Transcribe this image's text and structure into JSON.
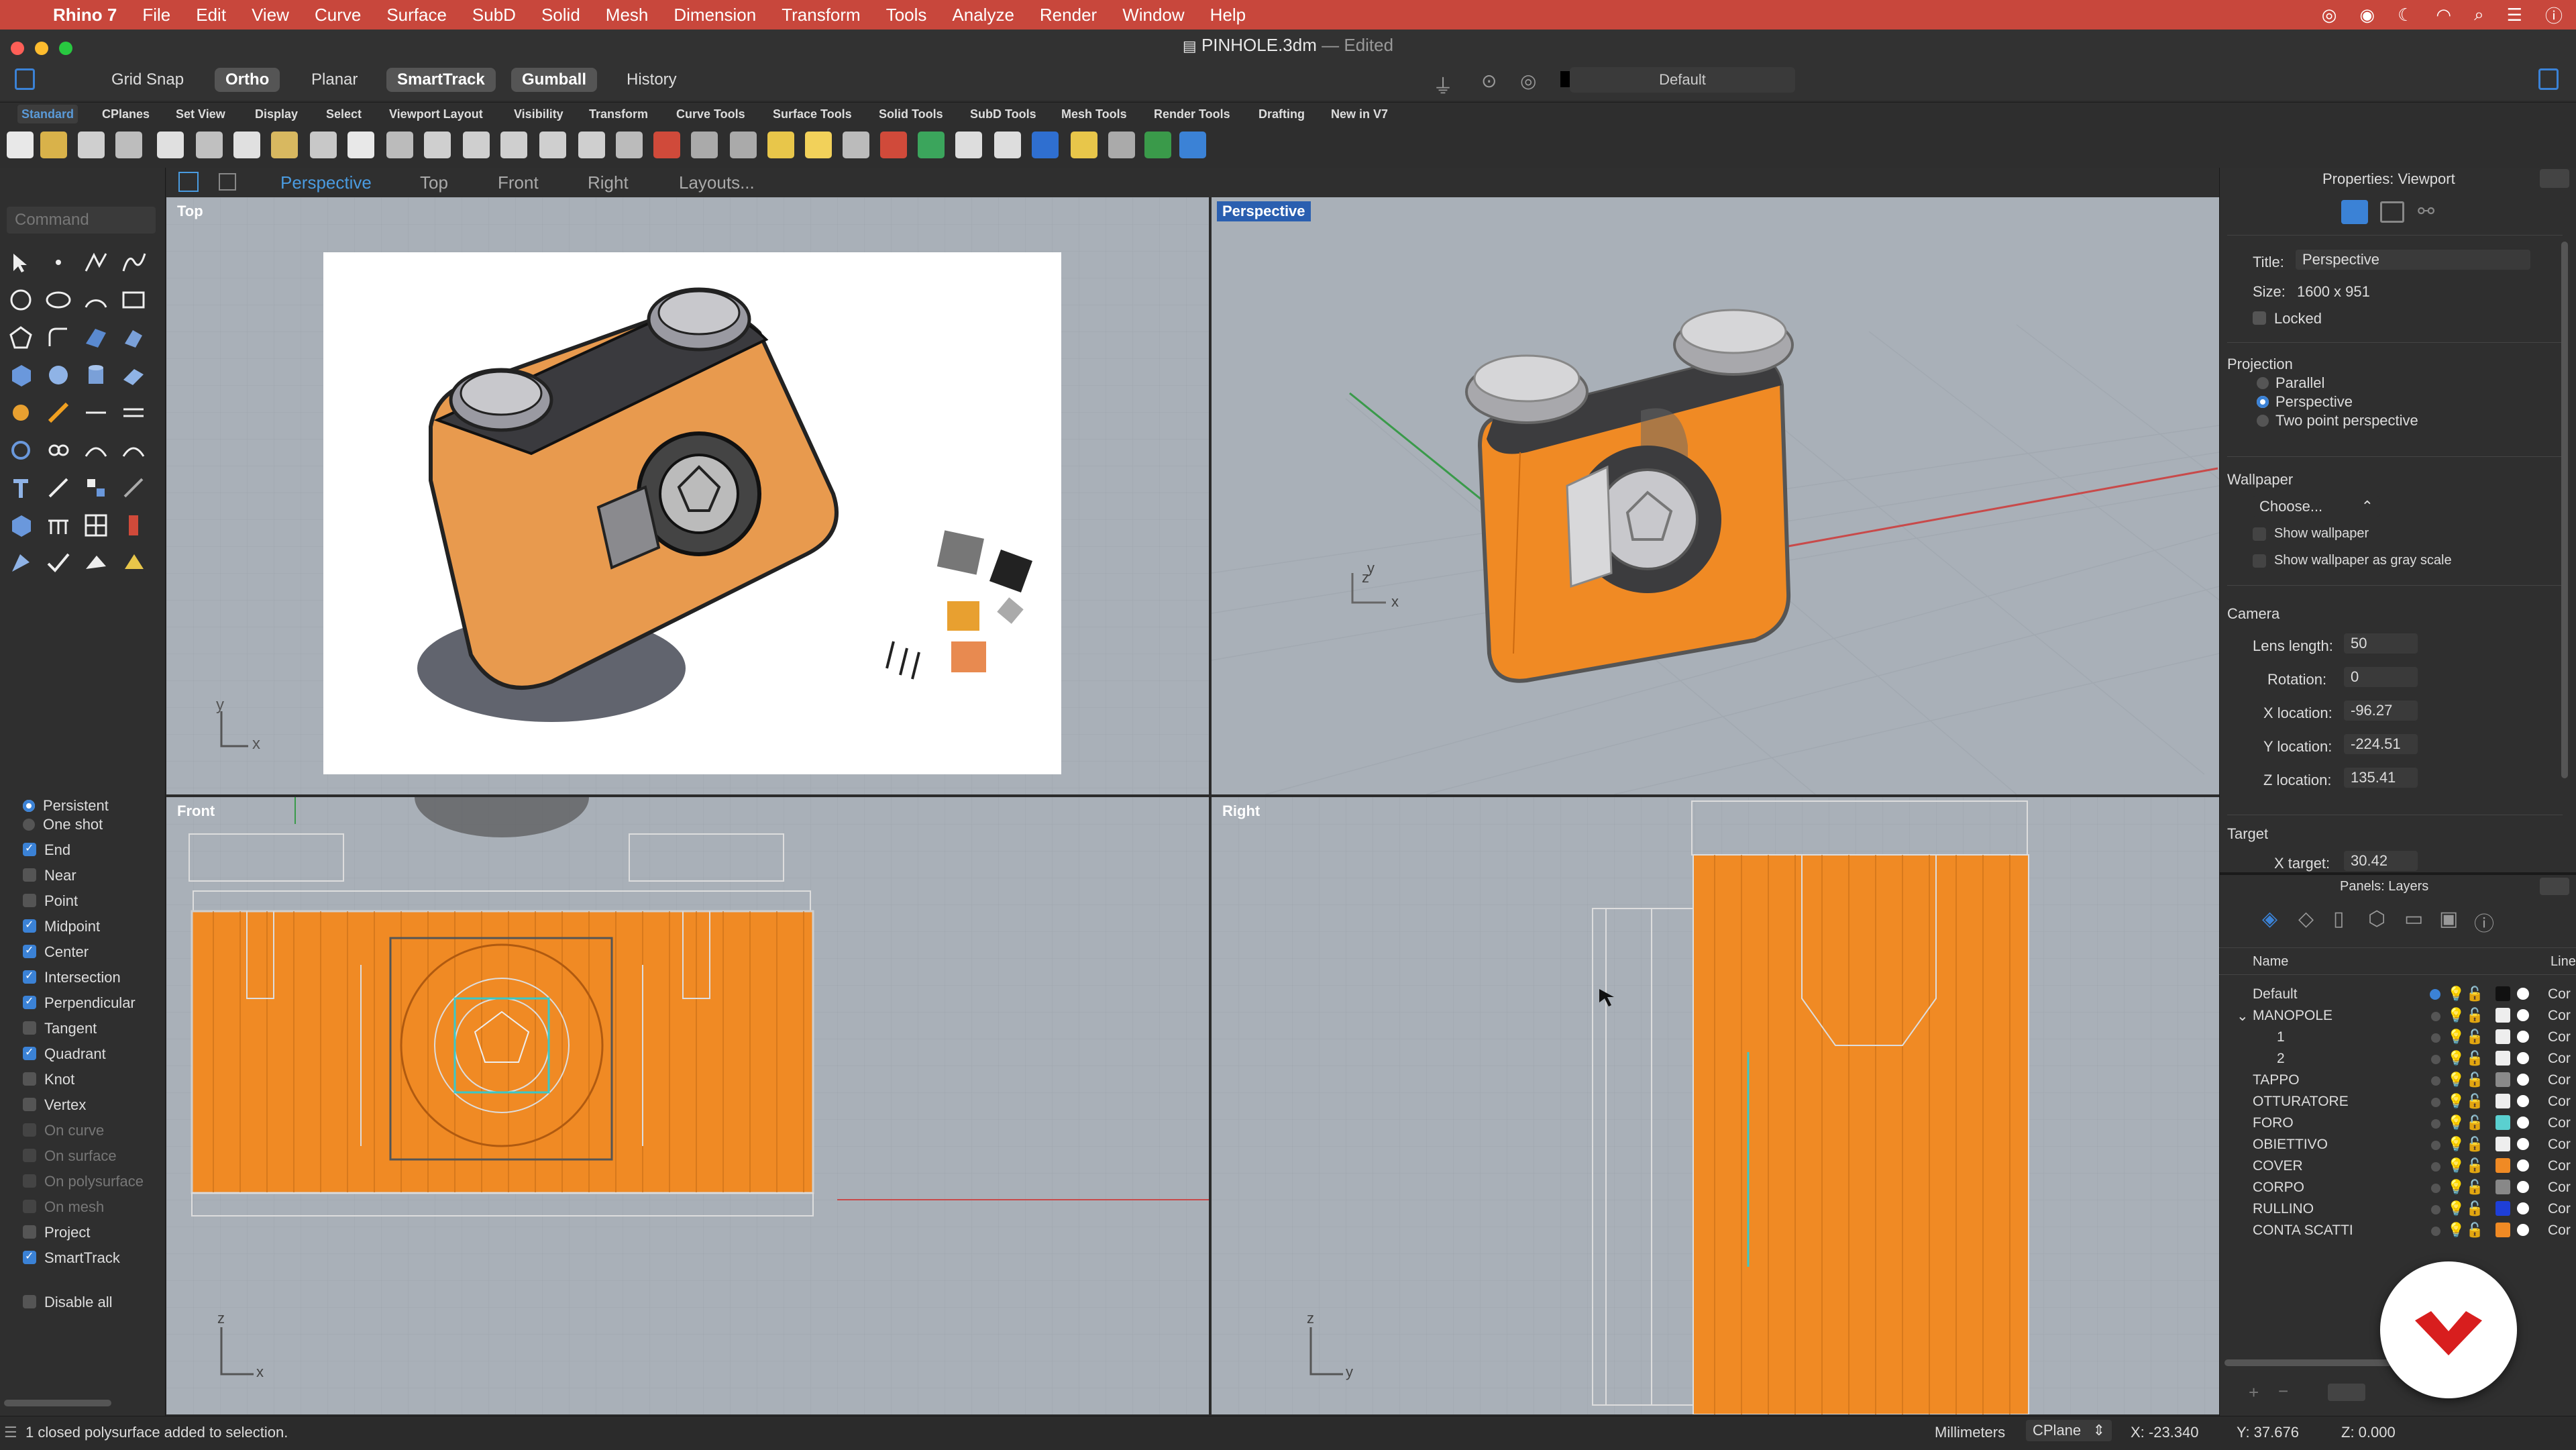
{
  "menubar": {
    "app": "Rhino 7",
    "items": [
      "File",
      "Edit",
      "View",
      "Curve",
      "Surface",
      "SubD",
      "Solid",
      "Mesh",
      "Dimension",
      "Transform",
      "Tools",
      "Analyze",
      "Render",
      "Window",
      "Help"
    ]
  },
  "window": {
    "filename": "PINHOLE.3dm",
    "status": "— Edited"
  },
  "toolbar": {
    "grid_snap": "Grid Snap",
    "ortho": "Ortho",
    "planar": "Planar",
    "smarttrack": "SmartTrack",
    "gumball": "Gumball",
    "history": "History",
    "layer": "Default"
  },
  "tabs": [
    "Standard",
    "CPlanes",
    "Set View",
    "Display",
    "Select",
    "Viewport Layout",
    "Visibility",
    "Transform",
    "Curve Tools",
    "Surface Tools",
    "Solid Tools",
    "SubD Tools",
    "Mesh Tools",
    "Render Tools",
    "Drafting",
    "New in V7"
  ],
  "command": {
    "placeholder": "Command"
  },
  "viewport_tabs": [
    "Perspective",
    "Top",
    "Front",
    "Right",
    "Layouts..."
  ],
  "viewports": {
    "top": "Top",
    "perspective": "Perspective",
    "front": "Front",
    "right": "Right"
  },
  "osnap": {
    "persistent": "Persistent",
    "one_shot": "One shot",
    "items": [
      {
        "label": "End",
        "checked": true
      },
      {
        "label": "Near",
        "checked": false
      },
      {
        "label": "Point",
        "checked": false
      },
      {
        "label": "Midpoint",
        "checked": true
      },
      {
        "label": "Center",
        "checked": true
      },
      {
        "label": "Intersection",
        "checked": true
      },
      {
        "label": "Perpendicular",
        "checked": true
      },
      {
        "label": "Tangent",
        "checked": false
      },
      {
        "label": "Quadrant",
        "checked": true
      },
      {
        "label": "Knot",
        "checked": false
      },
      {
        "label": "Vertex",
        "checked": false
      },
      {
        "label": "On curve",
        "checked": false
      },
      {
        "label": "On surface",
        "checked": false
      },
      {
        "label": "On polysurface",
        "checked": false
      },
      {
        "label": "On mesh",
        "checked": false
      },
      {
        "label": "Project",
        "checked": false
      },
      {
        "label": "SmartTrack",
        "checked": true
      }
    ],
    "disable_all": "Disable all"
  },
  "properties": {
    "title": "Properties: Viewport",
    "title_label": "Title:",
    "title_value": "Perspective",
    "size_label": "Size:",
    "size_value": "1600 x 951",
    "locked": "Locked",
    "projection": "Projection",
    "proj_options": [
      "Parallel",
      "Perspective",
      "Two point perspective"
    ],
    "wallpaper": "Wallpaper",
    "choose": "Choose...",
    "show_wallpaper": "Show wallpaper",
    "show_gray": "Show wallpaper as gray scale",
    "camera": "Camera",
    "lens_label": "Lens length:",
    "lens_value": "50",
    "rotation_label": "Rotation:",
    "rotation_value": "0",
    "xloc_label": "X location:",
    "xloc_value": "-96.27",
    "yloc_label": "Y location:",
    "yloc_value": "-224.51",
    "zloc_label": "Z location:",
    "zloc_value": "135.41",
    "target": "Target",
    "xtarget_label": "X target:",
    "xtarget_value": "30.42"
  },
  "layers": {
    "title": "Panels: Layers",
    "col_name": "Name",
    "col_line": "Line",
    "rows": [
      {
        "name": "Default",
        "color": "#111111"
      },
      {
        "name": "MANOPOLE",
        "color": "#eeeeee"
      },
      {
        "name": "1",
        "color": "#eeeeee"
      },
      {
        "name": "2",
        "color": "#eeeeee"
      },
      {
        "name": "TAPPO",
        "color": "#8a8a8a"
      },
      {
        "name": "OTTURATORE",
        "color": "#eeeeee"
      },
      {
        "name": "FORO",
        "color": "#5ad0d0"
      },
      {
        "name": "OBIETTIVO",
        "color": "#eeeeee"
      },
      {
        "name": "COVER",
        "color": "#f08a24"
      },
      {
        "name": "CORPO",
        "color": "#888888"
      },
      {
        "name": "RULLINO",
        "color": "#1e3fd8"
      },
      {
        "name": "CONTA SCATTI",
        "color": "#f08a24"
      }
    ],
    "line_abbr": "Cor"
  },
  "status": {
    "message": "1 closed polysurface added to selection.",
    "units": "Millimeters",
    "cplane": "CPlane",
    "x": "X: -23.340",
    "y": "Y: 37.676",
    "z": "Z: 0.000"
  },
  "colors": {
    "accent": "#3b82d6",
    "orange": "#f08a24",
    "menubar": "#c8473c"
  }
}
